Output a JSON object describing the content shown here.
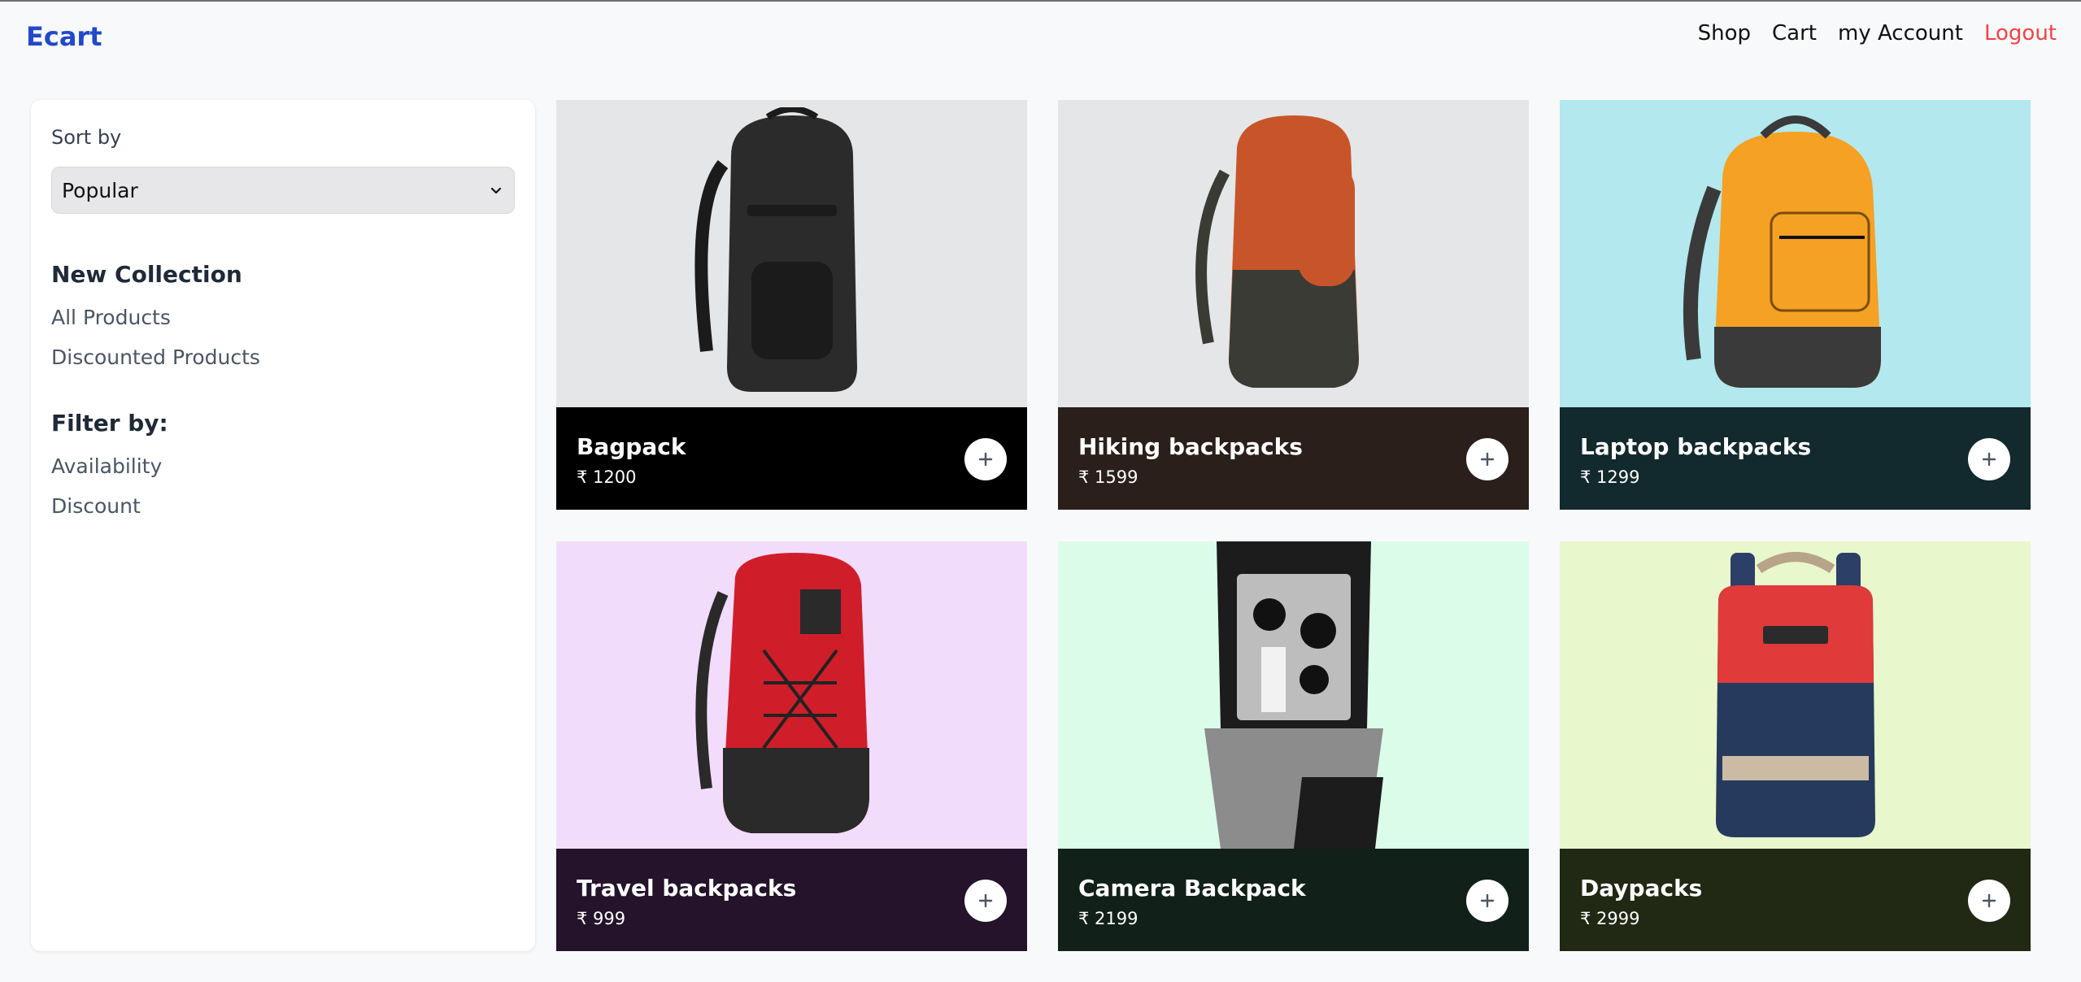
{
  "header": {
    "logo": "Ecart",
    "nav": {
      "shop": "Shop",
      "cart": "Cart",
      "account": "my Account",
      "logout": "Logout"
    }
  },
  "sidebar": {
    "sort_label": "Sort by",
    "sort_selected": "Popular",
    "collection_title": "New Collection",
    "collection_links": [
      "All Products",
      "Discounted Products"
    ],
    "filter_title": "Filter by:",
    "filter_links": [
      "Availability",
      "Discount"
    ]
  },
  "products": [
    {
      "name": "Bagpack",
      "price": "₹ 1200",
      "bg": "#e5e6e8",
      "panel": "#000000",
      "bag": "#2b2b2b",
      "accent": "#1b1b1b"
    },
    {
      "name": "Hiking backpacks",
      "price": "₹ 1599",
      "bg": "#e5e6e8",
      "panel": "#2a1f1a",
      "bag": "#c8552a",
      "accent": "#3b3b35"
    },
    {
      "name": "Laptop backpacks",
      "price": "₹ 1299",
      "bg": "#b3e8ef",
      "panel": "#12292d",
      "bag": "#f5a123",
      "accent": "#3a3a3a"
    },
    {
      "name": "Travel backpacks",
      "price": "₹ 999",
      "bg": "#f2dcfb",
      "panel": "#24132a",
      "bag": "#cf1e2a",
      "accent": "#2a2a2a"
    },
    {
      "name": "Camera Backpack",
      "price": "₹ 2199",
      "bg": "#dcfcea",
      "panel": "#11211a",
      "bag": "#1c1c1c",
      "accent": "#bdbdbd"
    },
    {
      "name": "Daypacks",
      "price": "₹ 2999",
      "bg": "#e8f8cc",
      "panel": "#212813",
      "bag": "#263a5e",
      "accent": "#e03a3a"
    }
  ]
}
